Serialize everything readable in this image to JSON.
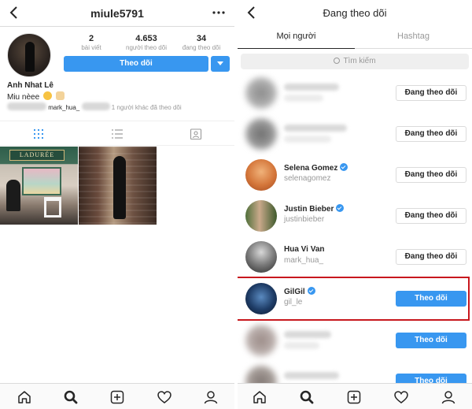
{
  "left": {
    "header": {
      "username": "miule5791"
    },
    "profile": {
      "stats": [
        {
          "value": "2",
          "label": "bài viết"
        },
        {
          "value": "4.653",
          "label": "người theo dõi"
        },
        {
          "value": "34",
          "label": "đang theo dõi"
        }
      ],
      "follow_button": "Theo dõi",
      "name": "Anh Nhat Lê",
      "bio": "Miu nèee",
      "mutual_user": "mark_hua_",
      "mutual_text": "1 người khác đã theo dõi"
    },
    "photos": {
      "sign_text": "LADURÉE"
    }
  },
  "right": {
    "header": {
      "title": "Đang theo dõi"
    },
    "tabs": {
      "people": "Mọi người",
      "hashtag": "Hashtag"
    },
    "search": {
      "placeholder": "Tìm kiếm"
    },
    "list": [
      {
        "name": "",
        "handle": "",
        "blurred": true,
        "button": "Đang theo dõi",
        "following": true
      },
      {
        "name": "",
        "handle": "",
        "blurred": true,
        "button": "Đang theo dõi",
        "following": true
      },
      {
        "name": "Selena Gomez",
        "handle": "selenagomez",
        "verified": true,
        "button": "Đang theo dõi",
        "following": true
      },
      {
        "name": "Justin Bieber",
        "handle": "justinbieber",
        "verified": true,
        "button": "Đang theo dõi",
        "following": true
      },
      {
        "name": "Hua Vi Van",
        "handle": "mark_hua_",
        "verified": false,
        "button": "Đang theo dõi",
        "following": true
      },
      {
        "name": "GilGil",
        "handle": "gil_le",
        "verified": true,
        "button": "Theo dõi",
        "following": false
      },
      {
        "name": "",
        "handle": "",
        "blurred": true,
        "button": "Theo dõi",
        "following": false
      },
      {
        "name": "",
        "handle": "",
        "blurred": true,
        "button": "Theo dõi",
        "following": false
      }
    ]
  },
  "theme": {
    "accent": "#3897f0",
    "highlight": "#c8181e",
    "muted": "#999999"
  }
}
